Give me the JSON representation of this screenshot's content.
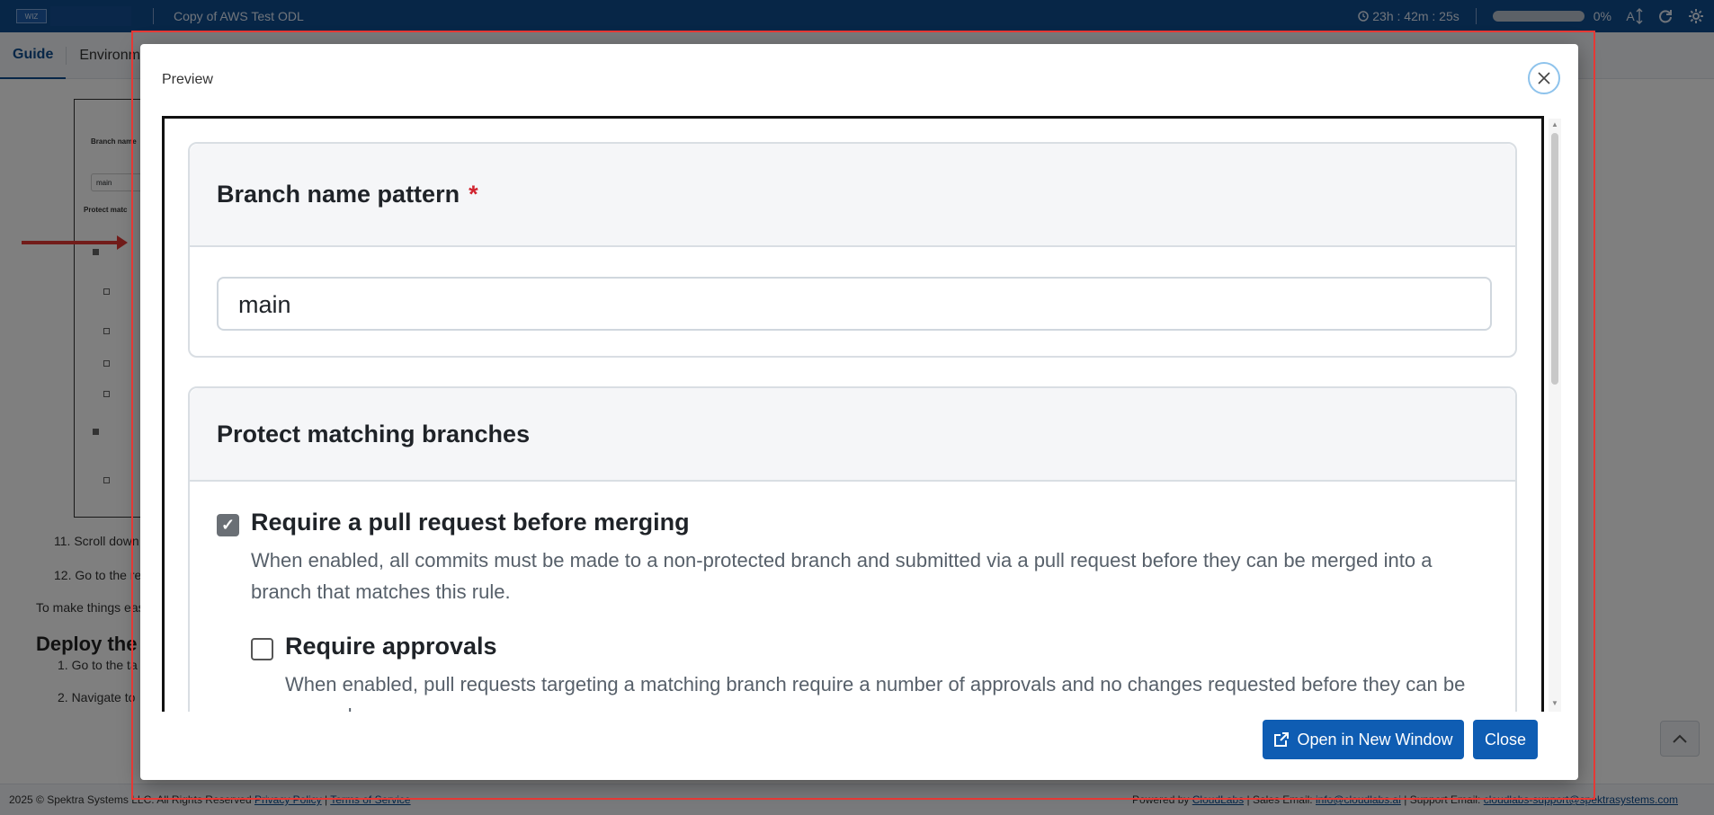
{
  "topbar": {
    "logo_text": "WIZ",
    "course_title": "Copy of AWS Test ODL",
    "timer": "23h : 42m : 25s",
    "progress_percent": "0%",
    "progress_value": 0,
    "font_label": "A"
  },
  "tabs": [
    {
      "label": "Guide"
    },
    {
      "label": "Environm"
    }
  ],
  "guide": {
    "shot_branch_label": "Branch name",
    "shot_input_value": "main",
    "shot_protect_label": "Protect matc",
    "step11": "11. Scroll down",
    "step12": "12. Go to the re",
    "note": "To make things eas",
    "heading": "Deploy the C",
    "sub1": "1. Go to the ta",
    "sub2": "2. Navigate to"
  },
  "footer": {
    "copyright": "2025 © Spektra Systems LLC. All Rights Reserved",
    "privacy": "Privacy Policy",
    "terms": "Terms of Service",
    "powered_by": "Powered by",
    "cloudlabs": "CloudLabs",
    "sales_label": "Sales Email:",
    "sales_email": "info@cloudlabs.ai",
    "support_label": "Support Email:",
    "support_email": "cloudlabs-support@spektrasystems.com"
  },
  "modal": {
    "title": "Preview",
    "open_button": "Open in New Window",
    "close_button": "Close"
  },
  "preview": {
    "branch_heading": "Branch name pattern",
    "required_mark": "*",
    "branch_value": "main",
    "protect_heading": "Protect matching branches",
    "options": [
      {
        "title": "Require a pull request before merging",
        "checked": true,
        "desc": "When enabled, all commits must be made to a non-protected branch and submitted via a pull request before they can be merged into a branch that matches this rule."
      },
      {
        "title": "Require approvals",
        "checked": false,
        "desc": "When enabled, pull requests targeting a matching branch require a number of approvals and no changes requested before they can be merged."
      }
    ]
  },
  "colors": {
    "topbar": "#0f4c8f",
    "primary_button": "#0f5db3",
    "required": "#d1242f",
    "highlight_outline": "#e53935"
  },
  "icons": {
    "timer": "clock-icon",
    "font_size": "text-size-icon",
    "refresh": "refresh-icon",
    "settings": "gear-icon",
    "close": "close-icon",
    "external": "external-link-icon",
    "scroll_top": "chevron-up-icon"
  }
}
